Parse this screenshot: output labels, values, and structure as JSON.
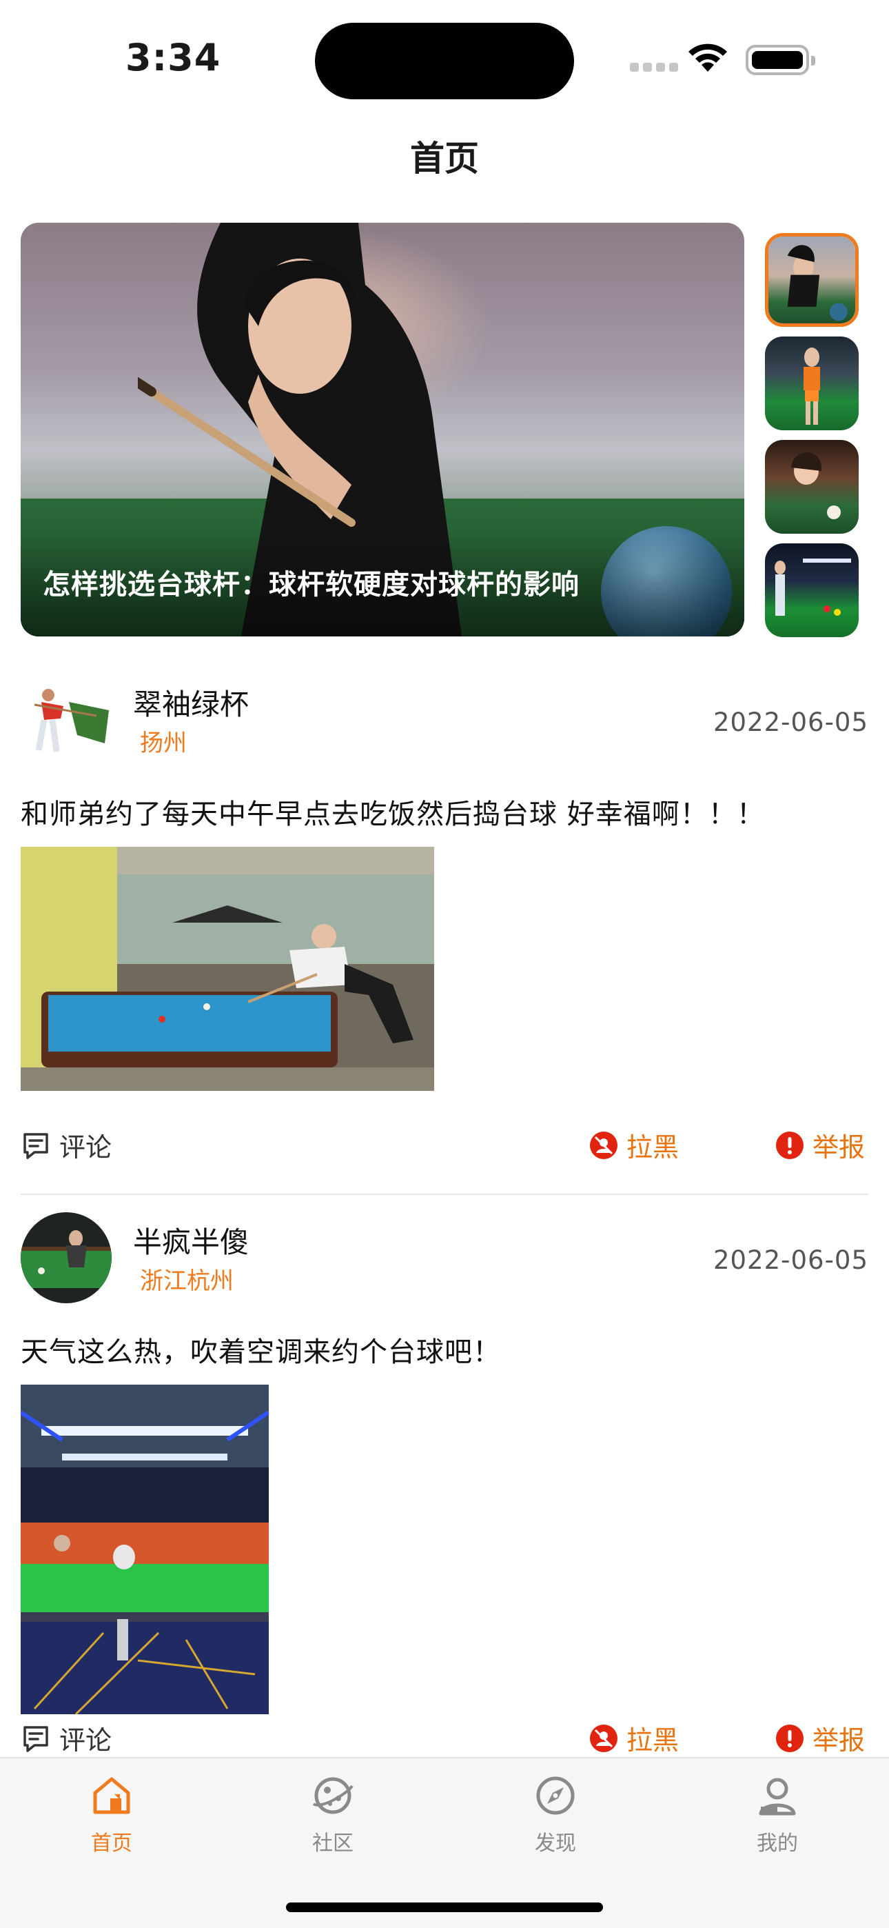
{
  "status_bar": {
    "time": "3:34"
  },
  "nav": {
    "title": "首页"
  },
  "banner": {
    "caption": "怎样挑选台球杆：球杆软硬度对球杆的影响",
    "thumbnails": [
      "billiards-player-thumb",
      "billiards-girl-thumb",
      "pool-table-thumb",
      "billiard-hall-thumb"
    ],
    "active_index": 0
  },
  "posts": [
    {
      "user_name": "翠袖绿杯",
      "location": "扬州",
      "date": "2022-06-05",
      "text": "和师弟约了每天中午早点去吃饭然后捣台球 好幸福啊！！！",
      "actions": {
        "comment": "评论",
        "block": "拉黑",
        "report": "举报"
      }
    },
    {
      "user_name": "半疯半傻",
      "location": "浙江杭州",
      "date": "2022-06-05",
      "text": "天气这么热，吹着空调来约个台球吧！",
      "actions": {
        "comment": "评论",
        "block": "拉黑",
        "report": "举报"
      }
    }
  ],
  "tab_bar": {
    "items": [
      {
        "label": "首页",
        "icon": "home-icon",
        "active": true
      },
      {
        "label": "社区",
        "icon": "planet-icon",
        "active": false
      },
      {
        "label": "发现",
        "icon": "compass-icon",
        "active": false
      },
      {
        "label": "我的",
        "icon": "user-icon",
        "active": false
      }
    ]
  },
  "colors": {
    "accent": "#f07a1e",
    "report_red": "#e0240f",
    "divider": "#e6e6e6"
  }
}
